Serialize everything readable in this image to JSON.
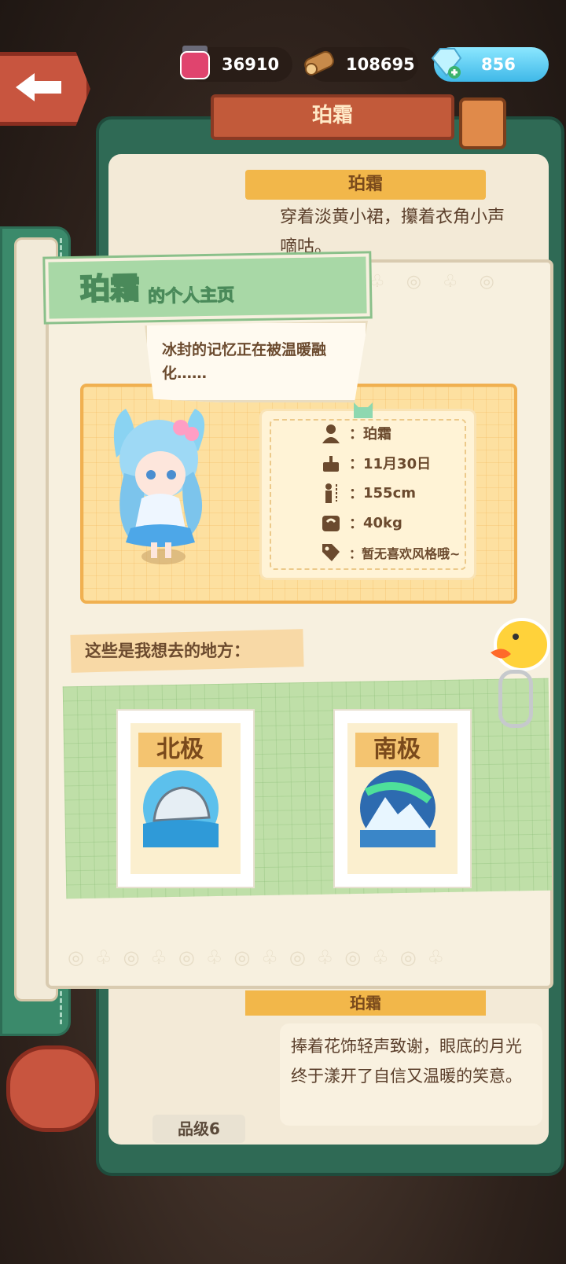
{
  "hud": {
    "ink": "36910",
    "wood": "108695",
    "gems": "856"
  },
  "under": {
    "title": "珀霜",
    "tag_top": "珀霜",
    "text_top": "穿着淡黄小裙，攥着衣角小声嘀咕。",
    "tag_bottom": "珀霜",
    "text_bottom": "捧着花饰轻声致谢，眼底的月光终于漾开了自信又温暖的笑意。",
    "grade": "品级6"
  },
  "profile": {
    "name": "珀霜",
    "suffix": "的个人主页",
    "speech": "冰封的记忆正在被温暖融化……",
    "stats": {
      "name": "珀霜",
      "birthday": "11月30日",
      "height": "155cm",
      "weight": "40kg",
      "style": "暂无喜欢风格哦~"
    },
    "places_label": "这些是我想去的地方：",
    "places": [
      {
        "name": "北极",
        "icon": "arctic-igloo-icon"
      },
      {
        "name": "南极",
        "icon": "antarctic-iceberg-icon"
      }
    ]
  },
  "colors": {
    "accent_green": "#a8d8a6",
    "card_orange": "#fde0a0",
    "gem_blue": "#3fb8e8"
  }
}
